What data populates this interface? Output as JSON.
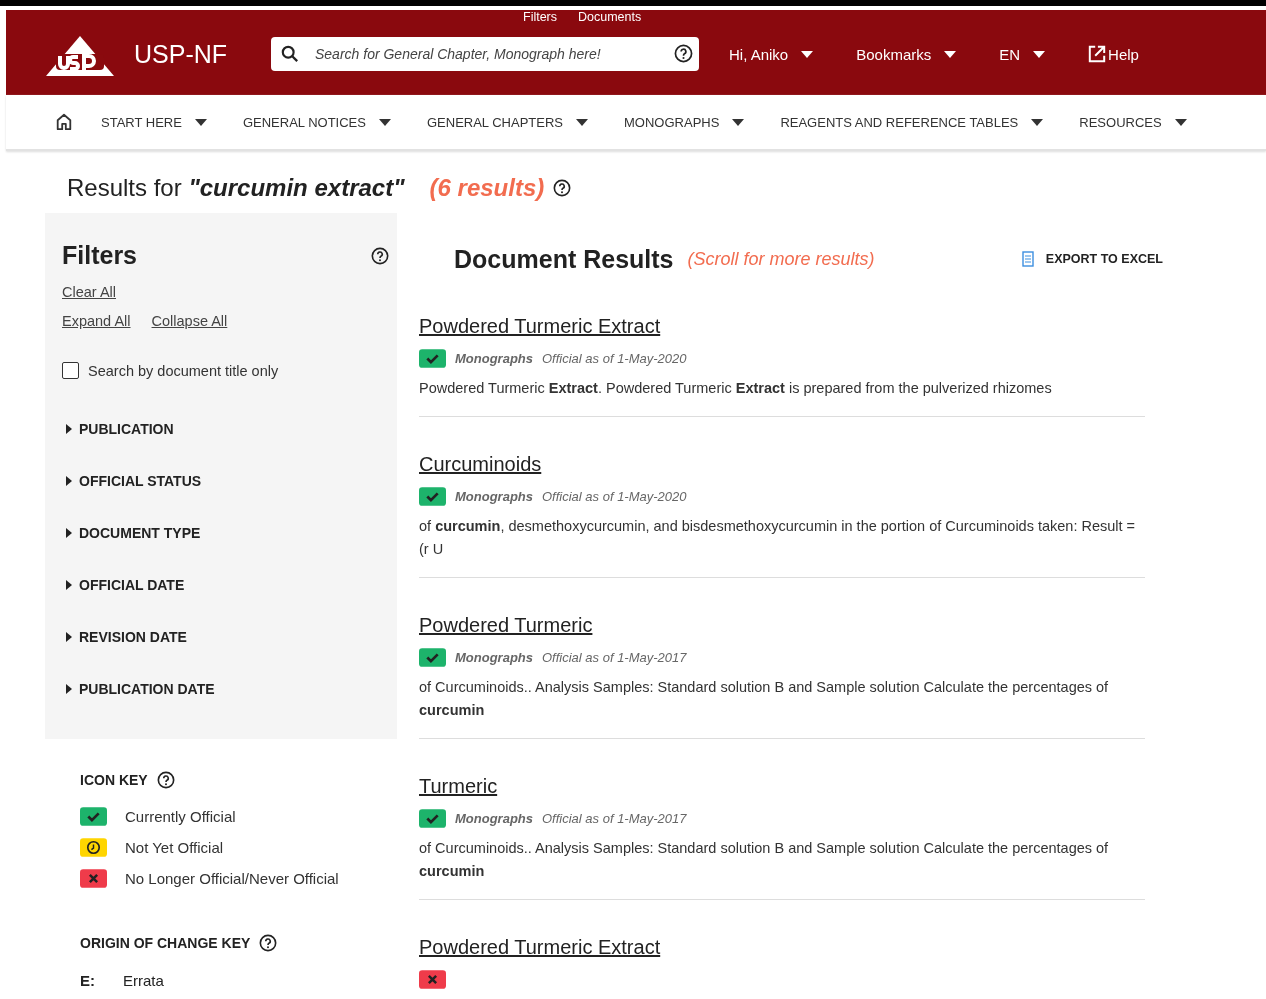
{
  "header": {
    "quick_links": [
      "Filters",
      "Documents"
    ],
    "logo_text": "USP-NF",
    "search": {
      "placeholder": "Search for General Chapter, Monograph here!"
    },
    "menus": [
      {
        "label": "Hi, Aniko",
        "kind": "dropdown"
      },
      {
        "label": "Bookmarks",
        "kind": "dropdown"
      },
      {
        "label": "EN",
        "kind": "dropdown"
      },
      {
        "label": "Help",
        "kind": "external"
      }
    ]
  },
  "nav": [
    "START HERE",
    "GENERAL NOTICES",
    "GENERAL CHAPTERS",
    "MONOGRAPHS",
    "REAGENTS AND REFERENCE TABLES",
    "RESOURCES"
  ],
  "results_heading": {
    "prefix": "Results for",
    "query": "\"curcumin extract\"",
    "count": "(6 results)"
  },
  "filters": {
    "title": "Filters",
    "clear_all": "Clear All",
    "expand_all": "Expand All",
    "collapse_all": "Collapse All",
    "title_only": {
      "label": "Search by document title only",
      "checked": false
    },
    "groups": [
      {
        "label": "PUBLICATION",
        "expanded": false
      },
      {
        "label": "OFFICIAL STATUS",
        "expanded": false
      },
      {
        "label": "DOCUMENT TYPE",
        "expanded": false
      },
      {
        "label": "OFFICIAL DATE",
        "expanded": false
      },
      {
        "label": "REVISION DATE",
        "expanded": false
      },
      {
        "label": "PUBLICATION DATE",
        "expanded": false
      }
    ]
  },
  "icon_key": {
    "title": "ICON KEY",
    "items": [
      {
        "label": "Currently Official",
        "kind": "current"
      },
      {
        "label": "Not Yet Official",
        "kind": "pending"
      },
      {
        "label": "No Longer Official/Never Official",
        "kind": "retired"
      }
    ]
  },
  "origin_key": {
    "title": "ORIGIN OF CHANGE KEY",
    "items": [
      {
        "code": "E:",
        "label": "Errata"
      }
    ]
  },
  "documents": {
    "title": "Document Results",
    "hint": "(Scroll for more results)",
    "export": "EXPORT TO EXCEL",
    "results": [
      {
        "title": "Powdered Turmeric Extract",
        "kind": "current",
        "type": "Monographs",
        "date": "Official as of 1-May-2020",
        "snippet": "Powdered Turmeric **Extract**. Powdered Turmeric **Extract** is prepared from the pulverized rhizomes"
      },
      {
        "title": "Curcuminoids",
        "kind": "current",
        "type": "Monographs",
        "date": "Official as of 1-May-2020",
        "snippet": "of **curcumin**, desmethoxycurcumin, and bisdesmethoxycurcumin in the portion of Curcuminoids taken: Result = (r U"
      },
      {
        "title": "Powdered Turmeric",
        "kind": "current",
        "type": "Monographs",
        "date": "Official as of 1-May-2017",
        "snippet": "of Curcuminoids.. Analysis Samples: Standard solution B and Sample solution Calculate the percentages of **curcumin**"
      },
      {
        "title": "Turmeric",
        "kind": "current",
        "type": "Monographs",
        "date": "Official as of 1-May-2017",
        "snippet": "of Curcuminoids.. Analysis Samples: Standard solution B and Sample solution Calculate the percentages of **curcumin**"
      },
      {
        "title": "Powdered Turmeric Extract",
        "kind": "retired"
      }
    ]
  }
}
